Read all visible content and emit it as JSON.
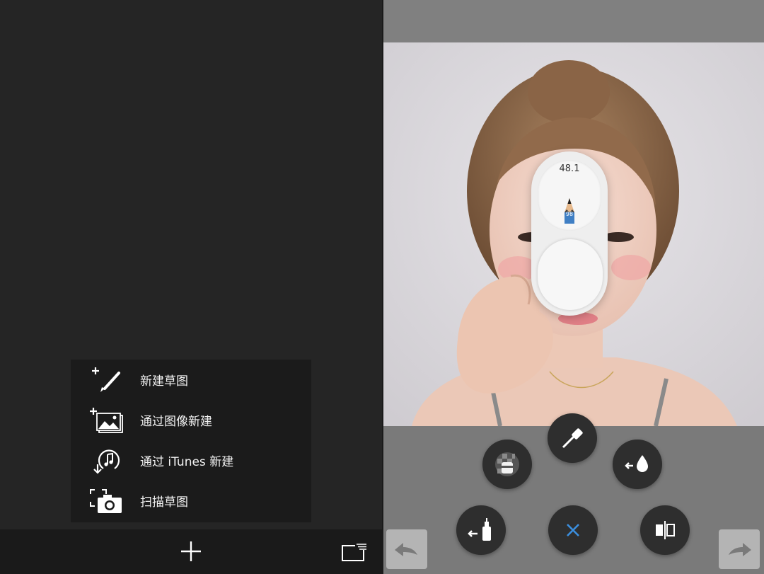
{
  "menu": {
    "items": [
      {
        "label": "新建草图",
        "icon": "new-sketch-icon"
      },
      {
        "label": "通过图像新建",
        "icon": "new-from-image-icon"
      },
      {
        "label": "通过 iTunes 新建",
        "icon": "new-from-itunes-icon"
      },
      {
        "label": "扫描草图",
        "icon": "scan-sketch-icon"
      }
    ]
  },
  "bottombar": {
    "add_icon": "plus-icon",
    "gallery_icon": "gallery-icon"
  },
  "brush": {
    "size": "48.1",
    "opacity": "98"
  },
  "tools": [
    "transparency-eraser-icon",
    "eyedropper-icon",
    "fill-icon",
    "paint-bucket-icon",
    "close-icon",
    "symmetry-icon"
  ],
  "colors": {
    "accent": "#3b8fe0",
    "panel": "#2e2e2e"
  }
}
